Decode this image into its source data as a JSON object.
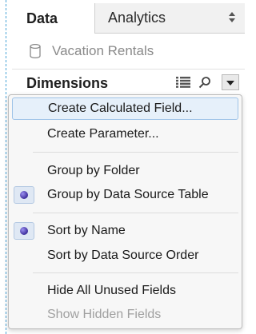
{
  "tabs": [
    {
      "label": "Data",
      "active": true
    },
    {
      "label": "Analytics",
      "active": false
    }
  ],
  "datasource": {
    "name": "Vacation Rentals",
    "icon": "database-icon"
  },
  "dimensions": {
    "title": "Dimensions"
  },
  "menu": {
    "items": [
      {
        "label": "Create Calculated Field...",
        "highlighted": true,
        "checked": false,
        "enabled": true
      },
      {
        "label": "Create Parameter...",
        "highlighted": false,
        "checked": false,
        "enabled": true
      },
      {
        "label": "Group by Folder",
        "highlighted": false,
        "checked": false,
        "enabled": true
      },
      {
        "label": "Group by Data Source Table",
        "highlighted": false,
        "checked": true,
        "enabled": true
      },
      {
        "label": "Sort by Name",
        "highlighted": false,
        "checked": true,
        "enabled": true
      },
      {
        "label": "Sort by Data Source Order",
        "highlighted": false,
        "checked": false,
        "enabled": true
      },
      {
        "label": "Hide All Unused Fields",
        "highlighted": false,
        "checked": false,
        "enabled": true
      },
      {
        "label": "Show Hidden Fields",
        "highlighted": false,
        "checked": false,
        "enabled": false
      }
    ]
  },
  "colors": {
    "highlight": "#e6f0fa",
    "radio": "#3e2f9c",
    "disabled_text": "#a0a0a0",
    "dashed_border": "#4aa3d8"
  }
}
